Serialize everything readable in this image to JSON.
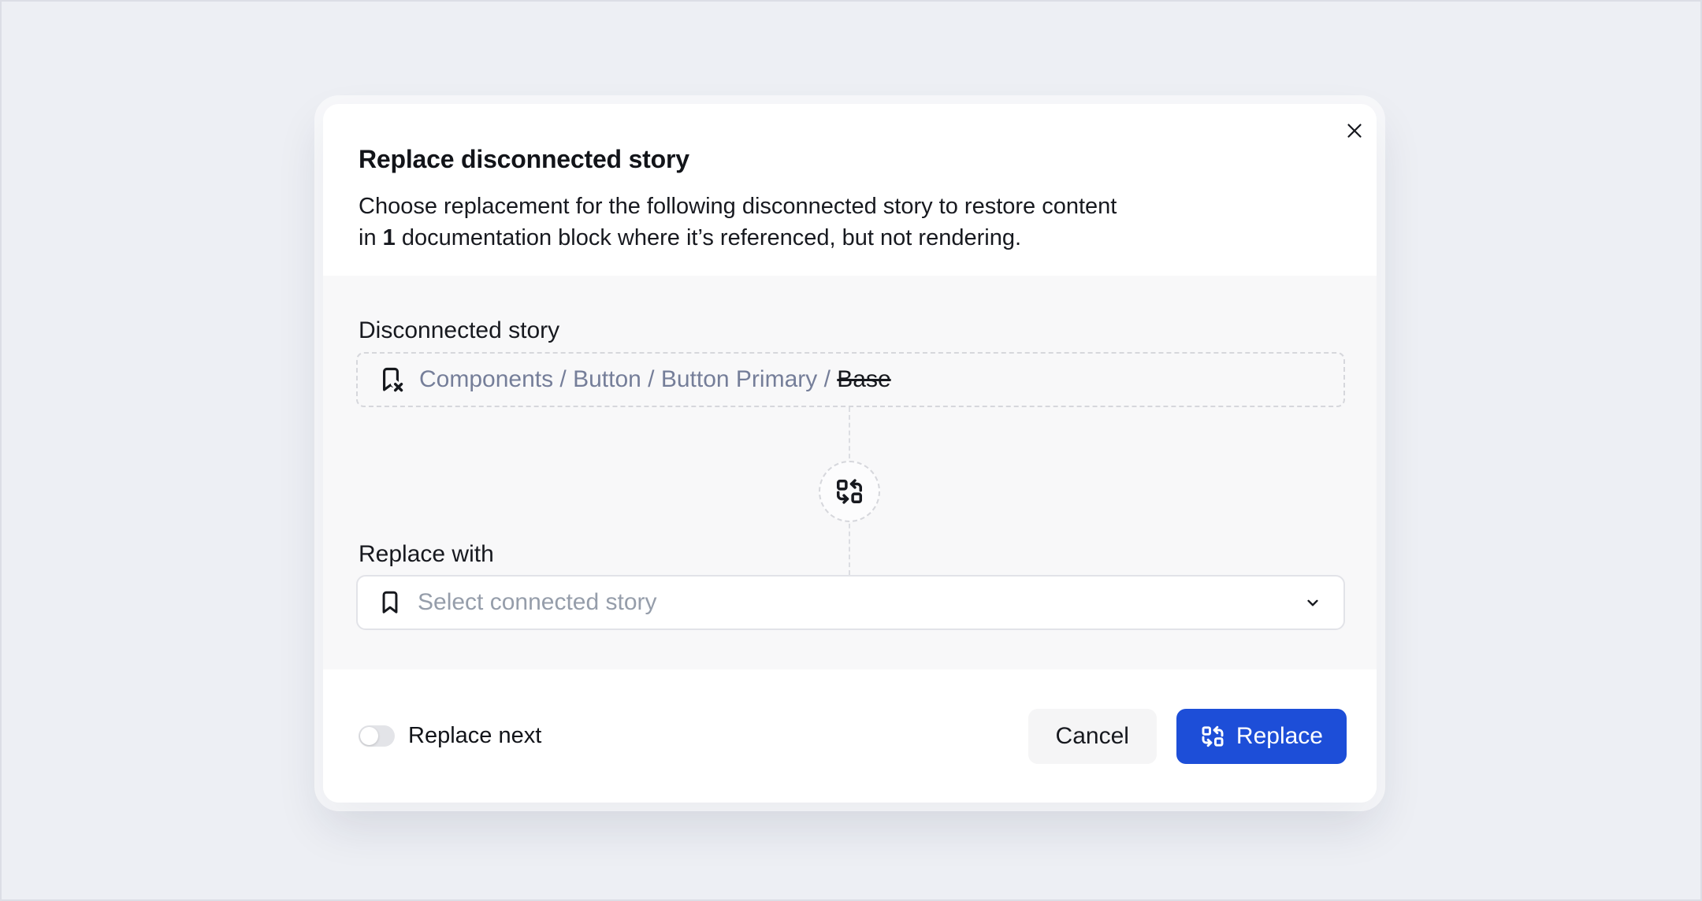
{
  "modal": {
    "title": "Replace disconnected story",
    "description": {
      "line1": "Choose replacement for the following disconnected story to restore content",
      "line2_prefix": "in",
      "line2_bold": "1",
      "line2_suffix": "documentation block where it’s referenced, but not rendering."
    },
    "close_icon": "x-icon"
  },
  "disconnected_story": {
    "label": "Disconnected story",
    "icon": "bookmark-x-icon",
    "path": "Components / Button / Button Primary /",
    "current": "Base",
    "current_style": "strikethrough"
  },
  "connector": {
    "icon": "replace-swap-icon"
  },
  "replace_with": {
    "label": "Replace with",
    "icon": "bookmark-icon",
    "placeholder": "Select connected story",
    "chevron_icon": "chevron-down-icon"
  },
  "footer": {
    "toggle_label": "Replace next",
    "toggle_state": "off",
    "cancel_label": "Cancel",
    "replace_label": "Replace",
    "replace_icon": "replace-swap-icon"
  },
  "colors": {
    "accent": "#1d4ed8",
    "page_bg": "#edeff4",
    "section_bg": "#f8f8f9",
    "breadcrumb_text": "#757e99",
    "placeholder_text": "#959daa",
    "dashed_border": "#d6d7dc"
  }
}
